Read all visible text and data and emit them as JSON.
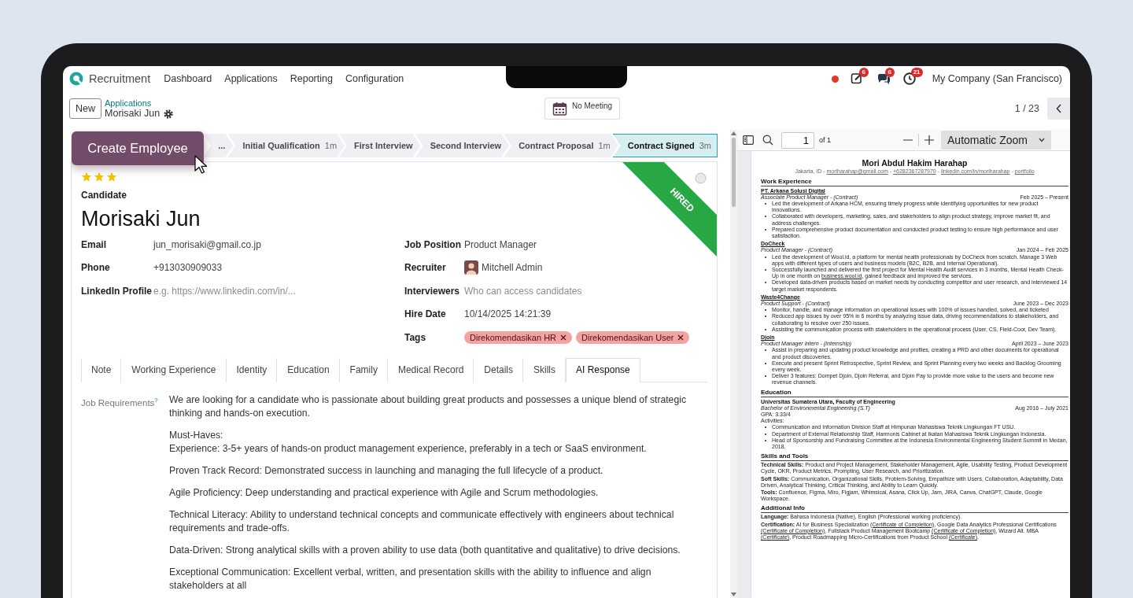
{
  "navbar": {
    "app_name": "Recruitment",
    "menu": [
      "Dashboard",
      "Applications",
      "Reporting",
      "Configuration"
    ],
    "systray": [
      {
        "kind": "dot"
      },
      {
        "kind": "activity",
        "badge": "6"
      },
      {
        "kind": "chat",
        "badge": "6"
      },
      {
        "kind": "clock",
        "badge": "21"
      }
    ],
    "company": "My Company (San Francisco)"
  },
  "control_bar": {
    "new_button": "New",
    "breadcrumb_parent": "Applications",
    "record_name": "Morisaki Jun",
    "meeting_button": "No Meeting",
    "pager": "1 / 23"
  },
  "create_employee_button": "Create Employee",
  "stages": [
    {
      "label": "...",
      "selected": false
    },
    {
      "label": "Initial Qualification",
      "duration": "1m",
      "selected": false
    },
    {
      "label": "First Interview",
      "selected": false
    },
    {
      "label": "Second Interview",
      "selected": false
    },
    {
      "label": "Contract Proposal",
      "duration": "1m",
      "selected": false
    },
    {
      "label": "Contract Signed",
      "duration": "3m",
      "selected": true
    }
  ],
  "applicant": {
    "stars": 3,
    "candidate_label": "Candidate",
    "name": "Morisaki Jun",
    "ribbon": "HIRED",
    "left_fields": [
      {
        "label": "Email",
        "kind": "text",
        "value": "jun_morisaki@gmail.co.jp"
      },
      {
        "label": "Phone",
        "kind": "text",
        "value": "+913030909033"
      },
      {
        "label": "LinkedIn Profile",
        "kind": "text",
        "placeholder": "e.g. https://www.linkedin.com/in/..."
      }
    ],
    "right_fields": [
      {
        "label": "Job Position",
        "kind": "text",
        "value": "Product Manager"
      },
      {
        "label": "Recruiter",
        "kind": "user",
        "value": "Mitchell Admin"
      },
      {
        "label": "Interviewers",
        "kind": "text",
        "placeholder": "Who can access candidates"
      },
      {
        "label": "Hire Date",
        "kind": "text",
        "value": "10/14/2025 14:21:39"
      },
      {
        "label": "Tags",
        "kind": "tags",
        "tags": [
          "Direkomendasikan HR",
          "Direkomendasikan User"
        ]
      }
    ]
  },
  "tabs": [
    {
      "label": "Note",
      "selected": false
    },
    {
      "label": "Working Experience",
      "selected": false
    },
    {
      "label": "Identity",
      "selected": false
    },
    {
      "label": "Education",
      "selected": false
    },
    {
      "label": "Family",
      "selected": false
    },
    {
      "label": "Medical Record",
      "selected": false
    },
    {
      "label": "Details",
      "selected": false
    },
    {
      "label": "Skills",
      "selected": false
    },
    {
      "label": "AI Response",
      "selected": true
    }
  ],
  "ai_response": {
    "label": "Job Requirements$^{?}$",
    "blocks": [
      [
        "We are looking for a candidate who is passionate about building great products and possesses a unique blend of strategic thinking and hands-on execution."
      ],
      [
        "Must-Haves:",
        "Experience: 3-5+ years of hands-on product management experience, preferably in a tech or SaaS environment."
      ],
      [
        "Proven Track Record: Demonstrated success in launching and managing the full lifecycle of a product."
      ],
      [
        "Agile Proficiency: Deep understanding and practical experience with Agile and Scrum methodologies."
      ],
      [
        "Technical Literacy: Ability to understand technical concepts and communicate effectively with engineers about technical requirements and trade-offs."
      ],
      [
        "Data-Driven: Strong analytical skills with a proven ability to use data (both quantitative and qualitative) to drive decisions."
      ],
      [
        "Exceptional Communication: Excellent verbal, written, and presentation skills with the ability to influence and align stakeholders at all"
      ]
    ]
  },
  "pdf_viewer": {
    "page_input": "1",
    "page_count": "of 1",
    "zoom": "Automatic Zoom",
    "resume": {
      "name": "Mori Abdul Hakim Harahap",
      "contact": [
        {
          "kind": "text",
          "text": "Jakarta, ID - "
        },
        {
          "kind": "link",
          "text": "moriharahap@gmail.com"
        },
        {
          "kind": "text",
          "text": " - "
        },
        {
          "kind": "link",
          "text": "+6282367287970"
        },
        {
          "kind": "text",
          "text": " - "
        },
        {
          "kind": "link",
          "text": "linkedin.com/in/moriharahap"
        },
        {
          "kind": "text",
          "text": " - "
        },
        {
          "kind": "link",
          "text": "portfolio"
        }
      ],
      "sections": [
        {
          "title": "Work Experience",
          "kind": "entries",
          "entries": [
            {
              "organization": "PT. Arkana Solusi Digital",
              "underlined": true,
              "role": "Associate Product Manager - (Contract)",
              "dates": "Feb 2025 – Present",
              "bullets": [
                "Led the development of Arkana HCM, ensuring timely progress while identifying opportunities for new product innovations.",
                "Collaborated with developers, marketing, sales, and stakeholders to align product strategy, improve market fit, and address challenges.",
                "Prepared comprehensive product documentation and conducted product testing to ensure high performance and user satisfaction."
              ]
            },
            {
              "organization": "DoCheck",
              "underlined": true,
              "role": "Product Manager - (Contract)",
              "dates": "Jan 2024 – Feb 2025",
              "bullets": [
                "Led the development of Wool.id, a platform for mental health professionals by DoCheck from scratch. Manage 3 Web apps with different types of users and business models (B2C, B2B, and Internal Operational).",
                [
                  {
                    "kind": "text",
                    "text": "Successfully launched and delivered the first project for Mental Health Audit services in 3 months, Mental Health Check-Up in one month on "
                  },
                  {
                    "kind": "link",
                    "text": "business.wool.id"
                  },
                  {
                    "kind": "text",
                    "text": ", gained feedback and improved the services."
                  }
                ],
                "Developed data-driven products based on market needs by conducting competitor and user research, and interviewed 14 target market respondents."
              ]
            },
            {
              "organization": "Waste4Change",
              "underlined": true,
              "role": "Product Support - (Contract)",
              "dates": "June 2023 – Dec 2023",
              "bullets": [
                "Monitor, handle, and manage information on operational issues with 100% of issues handled, solved, and ticketed",
                "Reduced app issues by over 95% in 6 months by analyzing issue data, driving recommendations to stakeholders, and collaborating to resolve over 250 issues.",
                "Assisting the communication process with stakeholders in the operational process (User, CS, Field-Coor, Dev Team)."
              ]
            },
            {
              "organization": "Djoin",
              "underlined": true,
              "role": "Product Manager Intern - (Internship)",
              "dates": "April 2023 – June 2023",
              "bullets": [
                "Assist in preparing and updating product knowledge and profiles, creating a PRD and other documents for operational and product discoveries.",
                "Execute and present Sprint Retrospective, Sprint Review, and Sprint Planning every two weeks and Backlog Grooming every week.",
                "Deliver 3 features: Dompet Djoin, Djoin Referral, and Djoin Pay to provide more value to the users and become new revenue channels."
              ]
            }
          ]
        },
        {
          "title": "Education",
          "kind": "entries",
          "entries": [
            {
              "organization": "Universitas Sumatera Utara, Faculty of Engineering",
              "underlined": false,
              "role": "Bachelor of Environmental Engineering (S.T)",
              "dates": "Aug 2016 – July 2021",
              "lines": [
                "GPA: 3.33/4",
                "Activities:"
              ],
              "bullets": [
                "Communication and Information Division Staff at Himpunan Mahasiswa Teknik Lingkungan FT USU.",
                "Department of External Relationship Staff, Harmonis Cabinet at Ikatan Mahasiswa Teknik Lingkungan Indonesia.",
                "Head of Sponsorship and Fundraising Committee at the Indonesia Environmental Engineering Student Summit in Medan, 2018."
              ]
            }
          ]
        },
        {
          "title": "Skills and Tools",
          "kind": "paragraphs",
          "paragraphs": [
            [
              {
                "kind": "label",
                "text": "Technical Skills:"
              },
              {
                "kind": "text",
                "text": " Product and Project Management, Stakeholder Management, Agile, Usability Testing, Product Development Cycle, OKR, Product Metrics, Prompting, User Research, and Prioritization."
              }
            ],
            [
              {
                "kind": "label",
                "text": "Soft Skills:"
              },
              {
                "kind": "text",
                "text": " Communication, Organizational Skills, Problem-Solving, Empathize with Users, Collaboration, Adaptability, Data Driven, Analytical Thinking, Critical Thinking, and Ability to Learn Quickly."
              }
            ],
            [
              {
                "kind": "label",
                "text": "Tools:"
              },
              {
                "kind": "text",
                "text": " Confluence, Figma, Miro, Figjam, Whimsical, Asana, Click Up, Jam, JIRA, Canva, ChatGPT, Claude, Google Workspace."
              }
            ]
          ]
        },
        {
          "title": "Additional Info",
          "kind": "paragraphs",
          "paragraphs": [
            [
              {
                "kind": "label",
                "text": "Language:"
              },
              {
                "kind": "text",
                "text": " Bahasa Indonesia (Native), English (Professional working proficiency)."
              }
            ],
            [
              {
                "kind": "label",
                "text": "Certification:"
              },
              {
                "kind": "text",
                "text": " AI for Business Specialization "
              },
              {
                "kind": "link",
                "text": "(Certificate of Completion)"
              },
              {
                "kind": "text",
                "text": ", Google Data Analytics Professional Certifications "
              },
              {
                "kind": "link",
                "text": "(Certificate of Completion)"
              },
              {
                "kind": "text",
                "text": ", Fullstack Product Management Bootcamp "
              },
              {
                "kind": "link",
                "text": "(Certificate of Completion)"
              },
              {
                "kind": "text",
                "text": ", Wizard Alt. MBA "
              },
              {
                "kind": "link",
                "text": "(Certificate)"
              },
              {
                "kind": "text",
                "text": ", Product Roadmapping Micro-Certifications from Product School "
              },
              {
                "kind": "link",
                "text": "(Certificate)"
              },
              {
                "kind": "text",
                "text": "."
              }
            ]
          ]
        }
      ]
    }
  }
}
